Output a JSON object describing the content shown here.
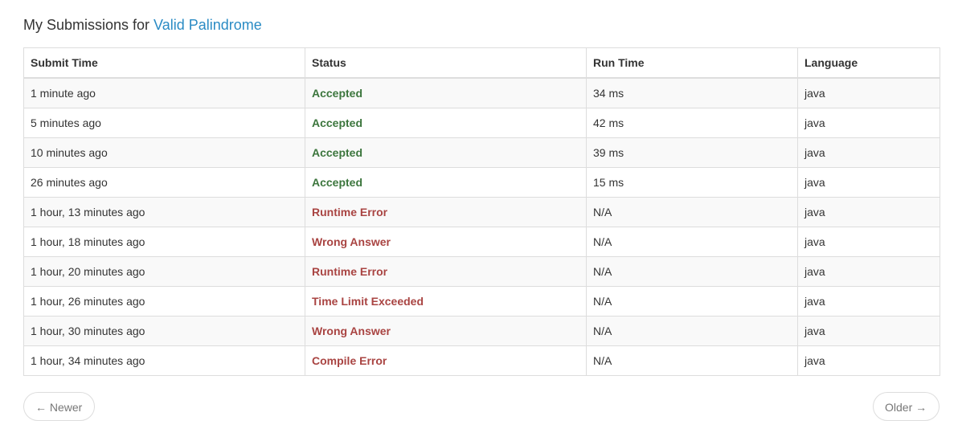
{
  "heading": {
    "prefix": "My Submissions for ",
    "problem": "Valid Palindrome"
  },
  "table": {
    "headers": [
      "Submit Time",
      "Status",
      "Run Time",
      "Language"
    ],
    "rows": [
      {
        "time": "1 minute ago",
        "status": "Accepted",
        "status_type": "ok",
        "runtime": "34 ms",
        "language": "java"
      },
      {
        "time": "5 minutes ago",
        "status": "Accepted",
        "status_type": "ok",
        "runtime": "42 ms",
        "language": "java"
      },
      {
        "time": "10 minutes ago",
        "status": "Accepted",
        "status_type": "ok",
        "runtime": "39 ms",
        "language": "java"
      },
      {
        "time": "26 minutes ago",
        "status": "Accepted",
        "status_type": "ok",
        "runtime": "15 ms",
        "language": "java"
      },
      {
        "time": "1 hour, 13 minutes ago",
        "status": "Runtime Error",
        "status_type": "err",
        "runtime": "N/A",
        "language": "java"
      },
      {
        "time": "1 hour, 18 minutes ago",
        "status": "Wrong Answer",
        "status_type": "err",
        "runtime": "N/A",
        "language": "java"
      },
      {
        "time": "1 hour, 20 minutes ago",
        "status": "Runtime Error",
        "status_type": "err",
        "runtime": "N/A",
        "language": "java"
      },
      {
        "time": "1 hour, 26 minutes ago",
        "status": "Time Limit Exceeded",
        "status_type": "err",
        "runtime": "N/A",
        "language": "java"
      },
      {
        "time": "1 hour, 30 minutes ago",
        "status": "Wrong Answer",
        "status_type": "err",
        "runtime": "N/A",
        "language": "java"
      },
      {
        "time": "1 hour, 34 minutes ago",
        "status": "Compile Error",
        "status_type": "err",
        "runtime": "N/A",
        "language": "java"
      }
    ]
  },
  "pager": {
    "newer_arrow": "←",
    "newer_label": "Newer",
    "older_label": "Older",
    "older_arrow": "→"
  },
  "colors": {
    "link": "#2a8bc4",
    "accepted": "#3c763d",
    "error": "#a94442"
  }
}
